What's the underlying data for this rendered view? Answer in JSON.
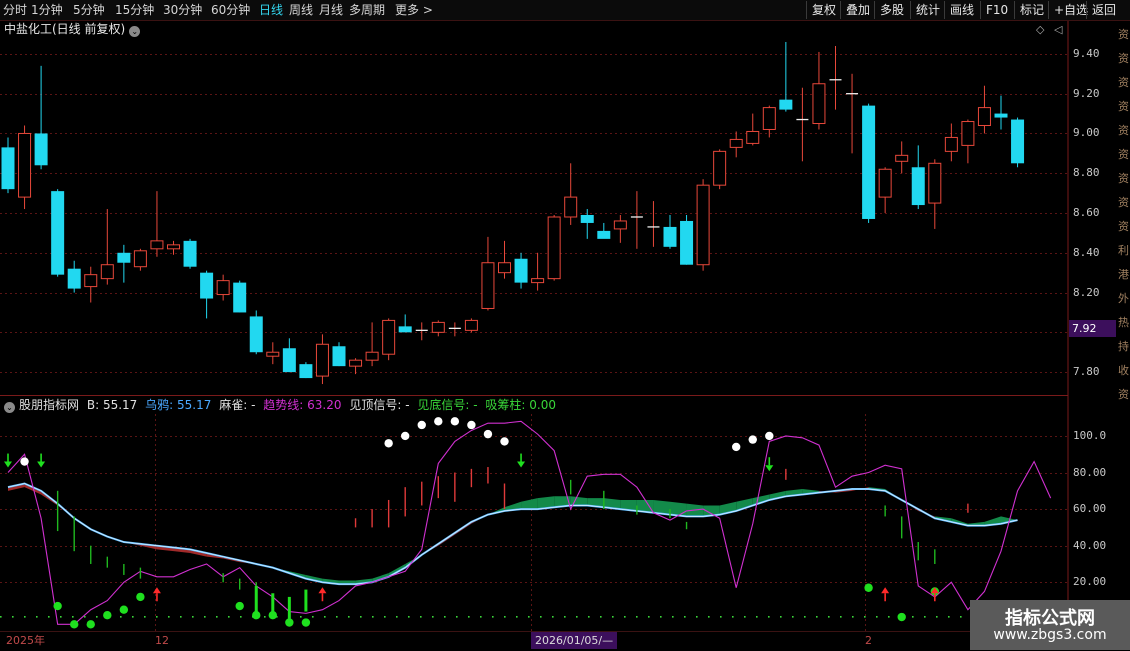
{
  "toolbar": {
    "periods": [
      {
        "label": "分时",
        "x": 3
      },
      {
        "label": "1分钟",
        "x": 31
      },
      {
        "label": "5分钟",
        "x": 73
      },
      {
        "label": "15分钟",
        "x": 115
      },
      {
        "label": "30分钟",
        "x": 163
      },
      {
        "label": "60分钟",
        "x": 211
      },
      {
        "label": "日线",
        "x": 259,
        "active": true
      },
      {
        "label": "周线",
        "x": 289
      },
      {
        "label": "月线",
        "x": 319
      },
      {
        "label": "多周期",
        "x": 349
      },
      {
        "label": "更多 >",
        "x": 395
      }
    ],
    "tools": [
      "复权",
      "叠加",
      "多股",
      "统计",
      "画线",
      "F10",
      "标记",
      "+自选",
      "返回"
    ]
  },
  "price_panel": {
    "title": "中盐化工(日线 前复权)",
    "last_price_tag": "7.92",
    "y_ticks": [
      "9.40",
      "9.20",
      "9.00",
      "8.80",
      "8.60",
      "8.40",
      "8.20",
      "8.00",
      "7.80"
    ]
  },
  "indicator_panel": {
    "name": "股朋指标网",
    "b_label": "B:",
    "b_value": "55.17",
    "wuya_label": "乌鸦:",
    "wuya_value": "55.17",
    "maque_label": "麻雀:",
    "maque_value": "-",
    "trend_label": "趋势线:",
    "trend_value": "63.20",
    "top_signal_label": "见顶信号:",
    "top_signal_value": "-",
    "bottom_signal_label": "见底信号:",
    "bottom_signal_value": "-",
    "absorb_label": "吸筹柱:",
    "absorb_value": "0.00",
    "y_ticks": [
      "100.0",
      "80.00",
      "60.00",
      "40.00",
      "20.00"
    ]
  },
  "date_axis": {
    "labels": [
      "2025年",
      "12",
      "2"
    ],
    "selected_date": "2026/01/05/—"
  },
  "watermark": {
    "line1": "指标公式网",
    "line2": "www.zbgs3.com"
  },
  "side_chars": [
    "资",
    "资",
    "资",
    "资",
    "资",
    "资",
    "资",
    "资",
    "资",
    "利",
    "港",
    "外",
    "热",
    "持",
    "收",
    "资"
  ],
  "colors": {
    "up": "#e8483a",
    "down": "#22d8f0",
    "bg": "#000000",
    "grid": "#5a1414",
    "accent_purple": "#d030d0",
    "accent_blue": "#4aa8ff"
  },
  "chart_data": {
    "type": "candlestick",
    "candles": [
      {
        "o": 8.93,
        "h": 8.98,
        "l": 8.7,
        "c": 8.72
      },
      {
        "o": 8.68,
        "h": 9.04,
        "l": 8.62,
        "c": 9.0
      },
      {
        "o": 9.0,
        "h": 9.34,
        "l": 8.82,
        "c": 8.84
      },
      {
        "o": 8.71,
        "h": 8.72,
        "l": 8.28,
        "c": 8.29
      },
      {
        "o": 8.32,
        "h": 8.36,
        "l": 8.2,
        "c": 8.22
      },
      {
        "o": 8.23,
        "h": 8.33,
        "l": 8.15,
        "c": 8.29
      },
      {
        "o": 8.27,
        "h": 8.62,
        "l": 8.24,
        "c": 8.34
      },
      {
        "o": 8.4,
        "h": 8.44,
        "l": 8.25,
        "c": 8.35
      },
      {
        "o": 8.33,
        "h": 8.42,
        "l": 8.31,
        "c": 8.41
      },
      {
        "o": 8.42,
        "h": 8.71,
        "l": 8.38,
        "c": 8.46
      },
      {
        "o": 8.42,
        "h": 8.46,
        "l": 8.39,
        "c": 8.44
      },
      {
        "o": 8.46,
        "h": 8.47,
        "l": 8.32,
        "c": 8.33
      },
      {
        "o": 8.3,
        "h": 8.31,
        "l": 8.07,
        "c": 8.17
      },
      {
        "o": 8.19,
        "h": 8.29,
        "l": 8.16,
        "c": 8.26
      },
      {
        "o": 8.25,
        "h": 8.26,
        "l": 8.1,
        "c": 8.1
      },
      {
        "o": 8.08,
        "h": 8.11,
        "l": 7.89,
        "c": 7.9
      },
      {
        "o": 7.88,
        "h": 7.95,
        "l": 7.84,
        "c": 7.9
      },
      {
        "o": 7.92,
        "h": 7.97,
        "l": 7.8,
        "c": 7.8
      },
      {
        "o": 7.84,
        "h": 7.85,
        "l": 7.77,
        "c": 7.77
      },
      {
        "o": 7.78,
        "h": 7.99,
        "l": 7.74,
        "c": 7.94
      },
      {
        "o": 7.93,
        "h": 7.95,
        "l": 7.83,
        "c": 7.83
      },
      {
        "o": 7.83,
        "h": 7.87,
        "l": 7.79,
        "c": 7.86
      },
      {
        "o": 7.86,
        "h": 8.05,
        "l": 7.83,
        "c": 7.9
      },
      {
        "o": 7.89,
        "h": 8.07,
        "l": 7.86,
        "c": 8.06
      },
      {
        "o": 8.03,
        "h": 8.09,
        "l": 8.02,
        "c": 8.0
      },
      {
        "o": 8.01,
        "h": 8.05,
        "l": 7.96,
        "c": 8.01
      },
      {
        "o": 8.0,
        "h": 8.06,
        "l": 7.98,
        "c": 8.05
      },
      {
        "o": 8.02,
        "h": 8.05,
        "l": 7.98,
        "c": 8.02
      },
      {
        "o": 8.01,
        "h": 8.07,
        "l": 8.0,
        "c": 8.06
      },
      {
        "o": 8.12,
        "h": 8.48,
        "l": 8.11,
        "c": 8.35
      },
      {
        "o": 8.3,
        "h": 8.46,
        "l": 8.27,
        "c": 8.35
      },
      {
        "o": 8.37,
        "h": 8.4,
        "l": 8.22,
        "c": 8.25
      },
      {
        "o": 8.25,
        "h": 8.4,
        "l": 8.21,
        "c": 8.27
      },
      {
        "o": 8.27,
        "h": 8.59,
        "l": 8.26,
        "c": 8.58
      },
      {
        "o": 8.58,
        "h": 8.85,
        "l": 8.54,
        "c": 8.68
      },
      {
        "o": 8.59,
        "h": 8.62,
        "l": 8.47,
        "c": 8.55
      },
      {
        "o": 8.51,
        "h": 8.55,
        "l": 8.48,
        "c": 8.47
      },
      {
        "o": 8.52,
        "h": 8.59,
        "l": 8.45,
        "c": 8.56
      },
      {
        "o": 8.58,
        "h": 8.71,
        "l": 8.42,
        "c": 8.58
      },
      {
        "o": 8.53,
        "h": 8.66,
        "l": 8.43,
        "c": 8.53
      },
      {
        "o": 8.53,
        "h": 8.59,
        "l": 8.42,
        "c": 8.43
      },
      {
        "o": 8.56,
        "h": 8.59,
        "l": 8.34,
        "c": 8.34
      },
      {
        "o": 8.34,
        "h": 8.77,
        "l": 8.31,
        "c": 8.74
      },
      {
        "o": 8.74,
        "h": 8.92,
        "l": 8.72,
        "c": 8.91
      },
      {
        "o": 8.93,
        "h": 9.01,
        "l": 8.88,
        "c": 8.97
      },
      {
        "o": 8.95,
        "h": 9.1,
        "l": 8.94,
        "c": 9.01
      },
      {
        "o": 9.02,
        "h": 9.14,
        "l": 8.98,
        "c": 9.13
      },
      {
        "o": 9.17,
        "h": 9.46,
        "l": 9.11,
        "c": 9.12
      },
      {
        "o": 9.07,
        "h": 9.23,
        "l": 8.86,
        "c": 9.07
      },
      {
        "o": 9.05,
        "h": 9.41,
        "l": 9.02,
        "c": 9.25
      },
      {
        "o": 9.27,
        "h": 9.44,
        "l": 9.12,
        "c": 9.27
      },
      {
        "o": 9.2,
        "h": 9.3,
        "l": 8.9,
        "c": 9.2
      },
      {
        "o": 9.14,
        "h": 9.15,
        "l": 8.55,
        "c": 8.57
      },
      {
        "o": 8.68,
        "h": 8.83,
        "l": 8.6,
        "c": 8.82
      },
      {
        "o": 8.86,
        "h": 8.96,
        "l": 8.8,
        "c": 8.89
      },
      {
        "o": 8.83,
        "h": 8.94,
        "l": 8.62,
        "c": 8.64
      },
      {
        "o": 8.65,
        "h": 8.87,
        "l": 8.52,
        "c": 8.85
      },
      {
        "o": 8.91,
        "h": 9.05,
        "l": 8.86,
        "c": 8.98
      },
      {
        "o": 8.94,
        "h": 9.07,
        "l": 8.85,
        "c": 9.06
      },
      {
        "o": 9.04,
        "h": 9.24,
        "l": 9.0,
        "c": 9.13
      },
      {
        "o": 9.1,
        "h": 9.19,
        "l": 9.02,
        "c": 9.08
      },
      {
        "o": 9.07,
        "h": 9.08,
        "l": 8.83,
        "c": 8.85
      }
    ],
    "yrange": [
      7.7,
      9.48
    ],
    "indicator_yrange": [
      -5,
      112
    ]
  }
}
